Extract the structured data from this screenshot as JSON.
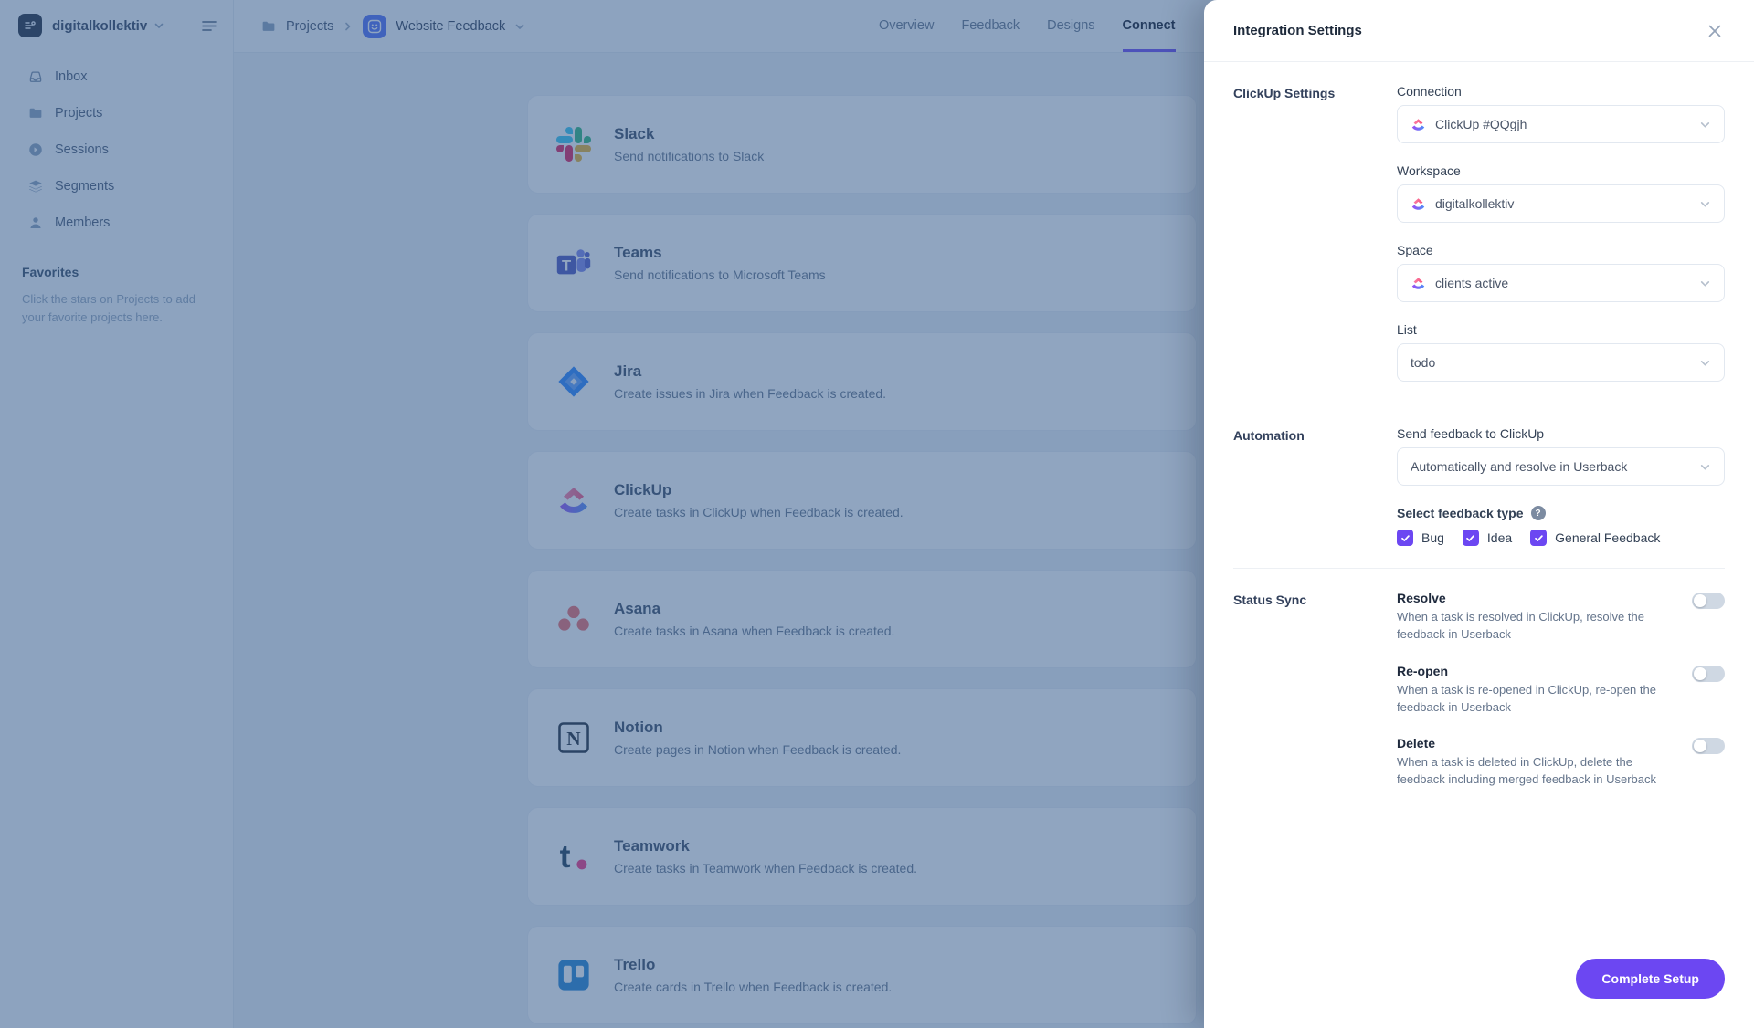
{
  "accent_color": "#6c47f2",
  "sidebar": {
    "workspace_name": "digitalkollektiv",
    "items": [
      {
        "icon": "inbox-icon",
        "label": "Inbox"
      },
      {
        "icon": "folder-icon",
        "label": "Projects"
      },
      {
        "icon": "play-circle-icon",
        "label": "Sessions"
      },
      {
        "icon": "layers-icon",
        "label": "Segments"
      },
      {
        "icon": "person-icon",
        "label": "Members"
      }
    ],
    "favorites_title": "Favorites",
    "favorites_hint": "Click the stars on Projects to add your favorite projects here."
  },
  "topbar": {
    "breadcrumb": {
      "root": "Projects",
      "project": "Website Feedback"
    },
    "tabs": [
      {
        "label": "Overview",
        "active": false
      },
      {
        "label": "Feedback",
        "active": false
      },
      {
        "label": "Designs",
        "active": false
      },
      {
        "label": "Connect",
        "active": true
      }
    ]
  },
  "integrations": [
    {
      "name": "Slack",
      "description": "Send notifications to Slack"
    },
    {
      "name": "Teams",
      "description": "Send notifications to Microsoft Teams"
    },
    {
      "name": "Jira",
      "description": "Create issues in Jira when Feedback is created."
    },
    {
      "name": "ClickUp",
      "description": "Create tasks in ClickUp when Feedback is created."
    },
    {
      "name": "Asana",
      "description": "Create tasks in Asana when Feedback is created."
    },
    {
      "name": "Notion",
      "description": "Create pages in Notion when Feedback is created."
    },
    {
      "name": "Teamwork",
      "description": "Create tasks in Teamwork when Feedback is created."
    },
    {
      "name": "Trello",
      "description": "Create cards in Trello when Feedback is created."
    }
  ],
  "panel": {
    "title": "Integration Settings",
    "clickup_settings": {
      "label": "ClickUp Settings",
      "fields": [
        {
          "label": "Connection",
          "value": "ClickUp #QQgjh",
          "has_icon": true
        },
        {
          "label": "Workspace",
          "value": "digitalkollektiv",
          "has_icon": true
        },
        {
          "label": "Space",
          "value": "clients active",
          "has_icon": true
        },
        {
          "label": "List",
          "value": "todo",
          "has_icon": false
        }
      ]
    },
    "automation": {
      "label": "Automation",
      "send_field": {
        "label": "Send feedback to ClickUp",
        "value": "Automatically and resolve in Userback"
      },
      "feedback_type_label": "Select feedback type",
      "feedback_types": [
        {
          "label": "Bug",
          "checked": true
        },
        {
          "label": "Idea",
          "checked": true
        },
        {
          "label": "General Feedback",
          "checked": true
        }
      ]
    },
    "status_sync": {
      "label": "Status Sync",
      "toggles": [
        {
          "title": "Resolve",
          "description": "When a task is resolved in ClickUp, resolve the feedback in Userback",
          "enabled": false
        },
        {
          "title": "Re-open",
          "description": "When a task is re-opened in ClickUp, re-open the feedback in Userback",
          "enabled": false
        },
        {
          "title": "Delete",
          "description": "When a task is deleted in ClickUp, delete the feedback including merged feedback in Userback",
          "enabled": false
        }
      ]
    },
    "footer": {
      "submit_label": "Complete Setup"
    }
  }
}
